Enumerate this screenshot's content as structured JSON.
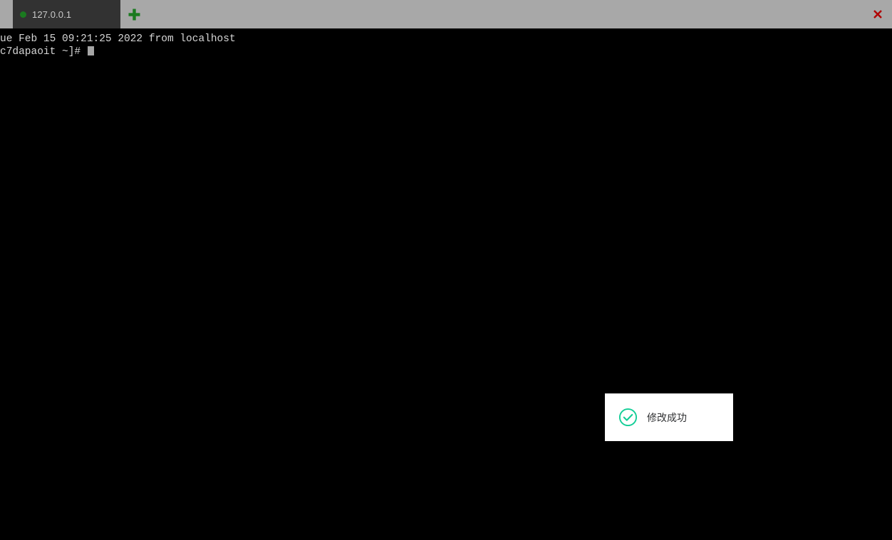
{
  "window": {
    "background_color": "#000000",
    "tabstrip_color": "#a8a8a8"
  },
  "tabstrip": {
    "tabs": [
      {
        "label": "127.0.0.1",
        "status_dot_color": "#1a7a1f",
        "active": true,
        "close_icon": "close-icon",
        "close_icon_color": "#b00000"
      }
    ],
    "add_tab": {
      "icon": "plus-icon",
      "color": "#1a7a1f"
    }
  },
  "terminal": {
    "prompt_color": "#d6d6d6",
    "lines": [
      "ue Feb 15 09:21:25 2022 from localhost",
      "c7dapaoit ~]# "
    ],
    "cursor": {
      "visible": true,
      "color": "#a6a6a6"
    }
  },
  "toast": {
    "message": "修改成功",
    "icon": "check-circle-icon",
    "icon_color": "#13ce97",
    "background_color": "#ffffff",
    "text_color": "#303133"
  }
}
